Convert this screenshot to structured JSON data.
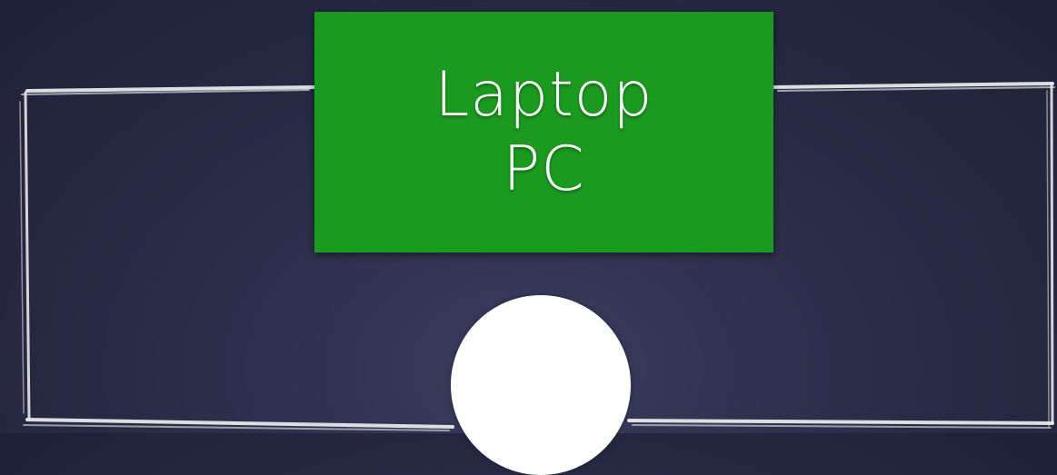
{
  "diagram": {
    "device_label_lines": [
      "Laptop",
      "PC"
    ],
    "colors": {
      "background": "#2b2d49",
      "device_box": "#1a9a1e",
      "device_text": "#ffffff",
      "frame_stroke": "#e6e6e6",
      "endpoint_circle": "#ffffff"
    }
  }
}
